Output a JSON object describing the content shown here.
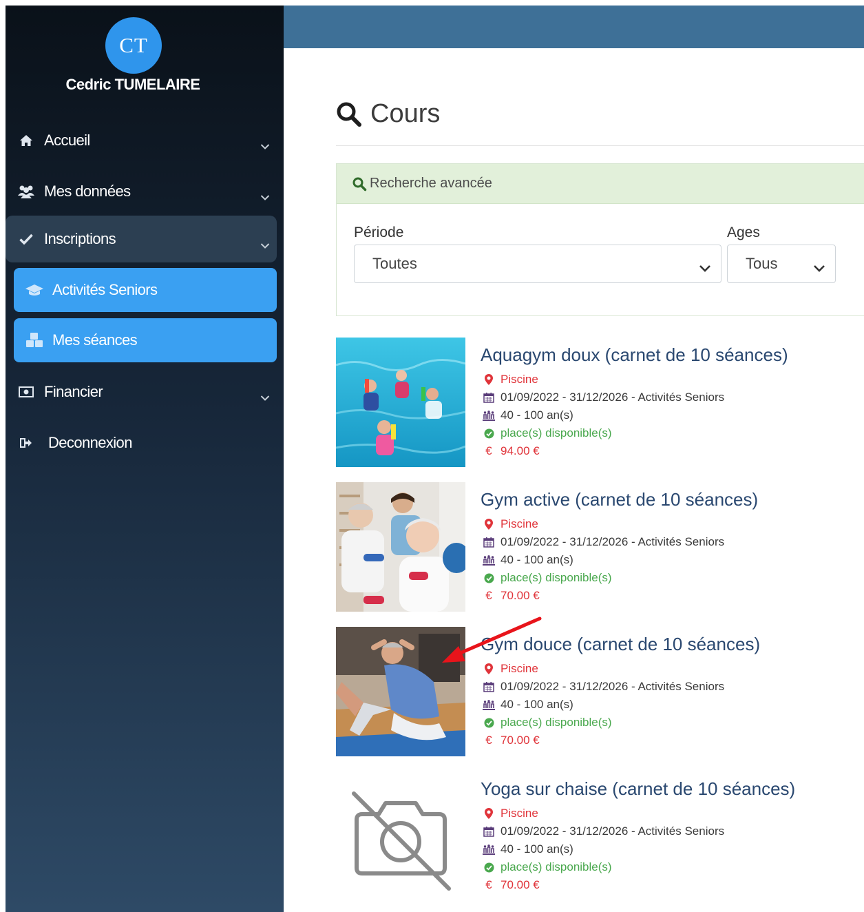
{
  "sidebar": {
    "avatar_initials": "CT",
    "user_name": "Cedric TUMELAIRE",
    "items": [
      {
        "label": "Accueil",
        "icon": "home-icon"
      },
      {
        "label": "Mes données",
        "icon": "users-icon"
      },
      {
        "label": "Inscriptions",
        "icon": "check-icon"
      },
      {
        "label": "Activités Seniors",
        "icon": "graduation-cap-icon"
      },
      {
        "label": "Mes séances",
        "icon": "cubes-icon"
      },
      {
        "label": "Financier",
        "icon": "money-icon"
      },
      {
        "label": "Deconnexion",
        "icon": "sign-out-icon"
      }
    ],
    "accent_color": "#3aa0f2"
  },
  "header": {
    "bar_color": "#3e7097"
  },
  "main": {
    "title": "Cours",
    "search": {
      "header": "Recherche avancée",
      "period_label": "Période",
      "period_value": "Toutes",
      "ages_label": "Ages",
      "ages_value": "Tous"
    },
    "courses": [
      {
        "title": "Aquagym doux (carnet de 10 séances)",
        "location": "Piscine",
        "dates": "01/09/2022 - 31/12/2026 - Activités Seniors",
        "ages": "40 - 100 an(s)",
        "availability": "place(s) disponible(s)",
        "price": "94.00 €",
        "image": "pool-photo"
      },
      {
        "title": "Gym active (carnet de 10 séances)",
        "location": "Piscine",
        "dates": "01/09/2022 - 31/12/2026 - Activités Seniors",
        "ages": "40 - 100 an(s)",
        "availability": "place(s) disponible(s)",
        "price": "70.00 €",
        "image": "dumbbell-photo"
      },
      {
        "title": "Gym douce (carnet de 10 séances)",
        "location": "Piscine",
        "dates": "01/09/2022 - 31/12/2026 - Activités Seniors",
        "ages": "40 - 100 an(s)",
        "availability": "place(s) disponible(s)",
        "price": "70.00 €",
        "image": "situp-photo"
      },
      {
        "title": "Yoga sur chaise (carnet de 10 séances)",
        "location": "Piscine",
        "dates": "01/09/2022 - 31/12/2026 - Activités Seniors",
        "ages": "40 - 100 an(s)",
        "availability": "place(s) disponible(s)",
        "price": "70.00 €",
        "image": "no-image-camera-icon"
      }
    ]
  },
  "euro_symbol": "€",
  "annotation_color": "#e8141b"
}
